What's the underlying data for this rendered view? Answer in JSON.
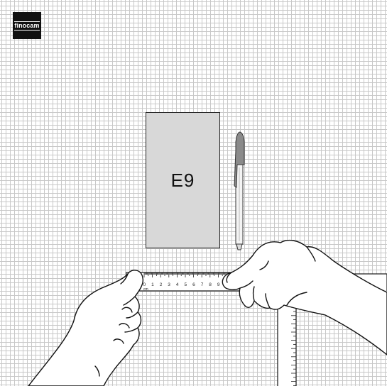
{
  "brand": {
    "logo_text": "finocam"
  },
  "notebook": {
    "size_label": "E9"
  },
  "ruler": {
    "tick_numbers": [
      "0",
      "1",
      "2",
      "3",
      "4",
      "5",
      "6",
      "7",
      "8",
      "9"
    ],
    "unit_label": "cm"
  },
  "colors": {
    "grid_line": "#c8c8c8",
    "notebook_fill": "#d8d8d8",
    "pen_cap": "#8a8a8a",
    "outline": "#222222"
  },
  "icons": [
    "finocam-logo",
    "notebook-illustration",
    "pen-illustration",
    "ruler-illustration",
    "hands-illustration"
  ]
}
